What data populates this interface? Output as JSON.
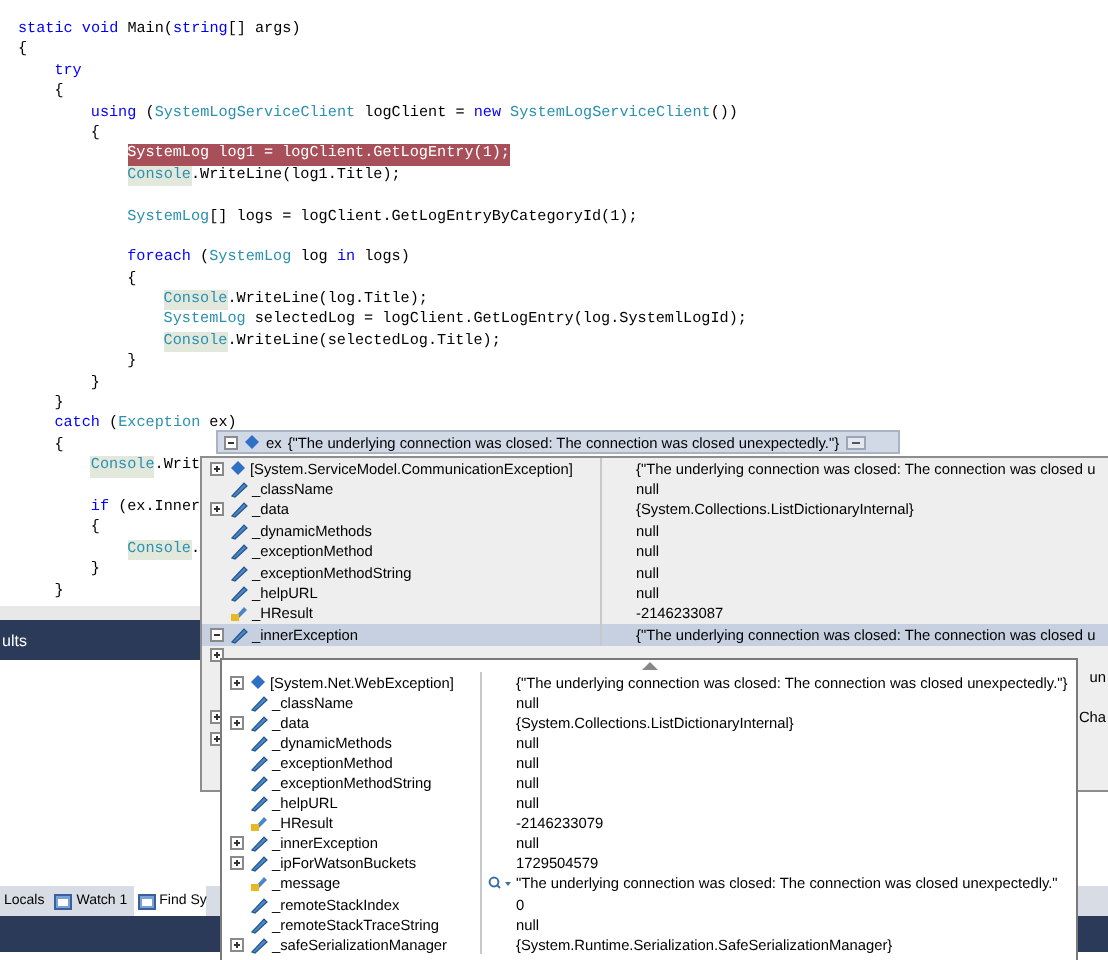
{
  "editor": {
    "lines": [
      {
        "kind": "code",
        "tokens": [
          {
            "t": "static",
            "kind": "kw"
          },
          {
            "t": " void",
            "kind": "kw"
          },
          {
            "t": " Main(",
            "kind": "plain"
          },
          {
            "t": "string",
            "kind": "kw"
          },
          {
            "t": "[] args)",
            "kind": "plain"
          }
        ]
      },
      {
        "kind": "code",
        "tokens": [
          {
            "t": "{",
            "kind": "plain"
          }
        ],
        "children": [
          {
            "kind": "code",
            "tokens": [
              {
                "t": "try",
                "kind": "kw"
              }
            ]
          },
          {
            "kind": "code",
            "tokens": [
              {
                "t": "{",
                "kind": "plain"
              }
            ],
            "children": [
              {
                "kind": "code",
                "tokens": [
                  {
                    "t": "using",
                    "kind": "kw"
                  },
                  {
                    "t": " (",
                    "kind": "plain"
                  },
                  {
                    "t": "SystemLogServiceClient",
                    "kind": "type"
                  },
                  {
                    "t": " logClient = ",
                    "kind": "plain"
                  },
                  {
                    "t": "new",
                    "kind": "kw"
                  },
                  {
                    "t": " SystemLogServiceClient",
                    "kind": "type"
                  },
                  {
                    "t": "())",
                    "kind": "plain"
                  }
                ]
              },
              {
                "kind": "code",
                "tokens": [
                  {
                    "t": "{",
                    "kind": "plain"
                  }
                ],
                "children": [
                  {
                    "kind": "code",
                    "tokens": [
                      {
                        "t": "SystemLog log1 = logClient.GetLogEntry(1);",
                        "kind": "current"
                      }
                    ]
                  },
                  {
                    "kind": "code",
                    "tokens": [
                      {
                        "t": "Console",
                        "kind": "ref"
                      },
                      {
                        "t": ".WriteLine(log1.Title);",
                        "kind": "plain"
                      }
                    ]
                  },
                  {
                    "kind": "blank"
                  },
                  {
                    "kind": "code",
                    "tokens": [
                      {
                        "t": "SystemLog",
                        "kind": "type"
                      },
                      {
                        "t": "[] logs = logClient.GetLogEntryByCategoryId(1);",
                        "kind": "plain"
                      }
                    ]
                  },
                  {
                    "kind": "blank"
                  },
                  {
                    "kind": "code",
                    "tokens": [
                      {
                        "t": "foreach",
                        "kind": "kw"
                      },
                      {
                        "t": " (",
                        "kind": "plain"
                      },
                      {
                        "t": "SystemLog",
                        "kind": "type"
                      },
                      {
                        "t": " log ",
                        "kind": "plain"
                      },
                      {
                        "t": "in",
                        "kind": "kw"
                      },
                      {
                        "t": " logs)",
                        "kind": "plain"
                      }
                    ]
                  },
                  {
                    "kind": "code",
                    "tokens": [
                      {
                        "t": "{",
                        "kind": "plain"
                      }
                    ],
                    "children": [
                      {
                        "kind": "code",
                        "tokens": [
                          {
                            "t": "Console",
                            "kind": "ref"
                          },
                          {
                            "t": ".WriteLine(log.Title);",
                            "kind": "plain"
                          }
                        ]
                      },
                      {
                        "kind": "code",
                        "tokens": [
                          {
                            "t": "SystemLog",
                            "kind": "type"
                          },
                          {
                            "t": " selectedLog = logClient.GetLogEntry(log.SystemlLogId);",
                            "kind": "plain"
                          }
                        ]
                      },
                      {
                        "kind": "code",
                        "tokens": [
                          {
                            "t": "Console",
                            "kind": "ref"
                          },
                          {
                            "t": ".WriteLine(selectedLog.Title);",
                            "kind": "plain"
                          }
                        ]
                      }
                    ]
                  },
                  {
                    "kind": "code",
                    "tokens": [
                      {
                        "t": "}",
                        "kind": "plain"
                      }
                    ]
                  }
                ]
              },
              {
                "kind": "code",
                "tokens": [
                  {
                    "t": "}",
                    "kind": "plain"
                  }
                ]
              }
            ]
          },
          {
            "kind": "code",
            "tokens": [
              {
                "t": "}",
                "kind": "plain"
              }
            ]
          },
          {
            "kind": "code",
            "tokens": [
              {
                "t": "catch",
                "kind": "kw"
              },
              {
                "t": " (",
                "kind": "plain"
              },
              {
                "t": "Exception",
                "kind": "type"
              },
              {
                "t": " ex)",
                "kind": "plain"
              }
            ]
          },
          {
            "kind": "code",
            "tokens": [
              {
                "t": "{",
                "kind": "plain"
              }
            ],
            "children": [
              {
                "kind": "code",
                "tokens": [
                  {
                    "t": "Console",
                    "kind": "ref"
                  },
                  {
                    "t": ".Writ",
                    "kind": "plain"
                  }
                ]
              },
              {
                "kind": "blank"
              },
              {
                "kind": "code",
                "tokens": [
                  {
                    "t": "if",
                    "kind": "kw"
                  },
                  {
                    "t": " (ex.Inner",
                    "kind": "plain"
                  }
                ]
              },
              {
                "kind": "code",
                "tokens": [
                  {
                    "t": "{",
                    "kind": "plain"
                  }
                ],
                "children": [
                  {
                    "kind": "code",
                    "tokens": [
                      {
                        "t": "Console",
                        "kind": "ref"
                      },
                      {
                        "t": ".",
                        "kind": "plain"
                      }
                    ]
                  }
                ]
              },
              {
                "kind": "code",
                "tokens": [
                  {
                    "t": "}",
                    "kind": "plain"
                  }
                ]
              }
            ]
          },
          {
            "kind": "code",
            "tokens": [
              {
                "t": "}",
                "kind": "plain"
              }
            ]
          }
        ]
      }
    ]
  },
  "output_panel": {
    "title": "ults"
  },
  "bottom_tabs": [
    {
      "label": "Locals",
      "icon": false,
      "selected": false
    },
    {
      "label": "Watch 1",
      "icon": true,
      "selected": false
    },
    {
      "label": "Find Sy",
      "icon": true,
      "selected": true
    }
  ],
  "datatip": {
    "name": "ex",
    "value": "{\"The underlying connection was closed: The connection was closed unexpectedly.\"}",
    "rows": [
      {
        "name": "[System.ServiceModel.CommunicationException]",
        "value": "{\"The underlying connection was closed: The connection was closed u",
        "kind": "property",
        "expandable": true,
        "expanded": false,
        "selected": false
      },
      {
        "name": "_className",
        "value": "null",
        "kind": "field",
        "expandable": false,
        "selected": false
      },
      {
        "name": "_data",
        "value": "{System.Collections.ListDictionaryInternal}",
        "kind": "field",
        "expandable": true,
        "expanded": false,
        "selected": false
      },
      {
        "name": "_dynamicMethods",
        "value": "null",
        "kind": "field",
        "expandable": false,
        "selected": false
      },
      {
        "name": "_exceptionMethod",
        "value": "null",
        "kind": "field",
        "expandable": false,
        "selected": false
      },
      {
        "name": "_exceptionMethodString",
        "value": "null",
        "kind": "field",
        "expandable": false,
        "selected": false
      },
      {
        "name": "_helpURL",
        "value": "null",
        "kind": "field",
        "expandable": false,
        "selected": false
      },
      {
        "name": "_HResult",
        "value": "-2146233087",
        "kind": "locked",
        "expandable": false,
        "selected": false
      },
      {
        "name": "_innerException",
        "value": "{\"The underlying connection was closed: The connection was closed u",
        "kind": "field",
        "expandable": true,
        "expanded": true,
        "selected": true
      }
    ],
    "covered_rows": [
      {
        "expandable": true
      },
      {
        "expandable": false,
        "value_end": "un"
      },
      {
        "expandable": false
      },
      {
        "expandable": true,
        "value_end": "Cha"
      },
      {
        "expandable": true
      },
      {
        "expandable": false
      },
      {
        "expandable": false
      }
    ],
    "child": {
      "rows": [
        {
          "name": "[System.Net.WebException]",
          "value": "{\"The underlying connection was closed: The connection was closed unexpectedly.\"}",
          "kind": "property",
          "expandable": true,
          "visualizer": false
        },
        {
          "name": "_className",
          "value": "null",
          "kind": "field",
          "expandable": false,
          "visualizer": false
        },
        {
          "name": "_data",
          "value": "{System.Collections.ListDictionaryInternal}",
          "kind": "field",
          "expandable": true,
          "visualizer": false
        },
        {
          "name": "_dynamicMethods",
          "value": "null",
          "kind": "field",
          "expandable": false,
          "visualizer": false
        },
        {
          "name": "_exceptionMethod",
          "value": "null",
          "kind": "field",
          "expandable": false,
          "visualizer": false
        },
        {
          "name": "_exceptionMethodString",
          "value": "null",
          "kind": "field",
          "expandable": false,
          "visualizer": false
        },
        {
          "name": "_helpURL",
          "value": "null",
          "kind": "field",
          "expandable": false,
          "visualizer": false
        },
        {
          "name": "_HResult",
          "value": "-2146233079",
          "kind": "locked",
          "expandable": false,
          "visualizer": false
        },
        {
          "name": "_innerException",
          "value": "null",
          "kind": "field",
          "expandable": true,
          "visualizer": false
        },
        {
          "name": "_ipForWatsonBuckets",
          "value": "1729504579",
          "kind": "field",
          "expandable": true,
          "visualizer": false
        },
        {
          "name": "_message",
          "value": "\"The underlying connection was closed: The connection was closed unexpectedly.\"",
          "kind": "locked",
          "expandable": false,
          "visualizer": true
        },
        {
          "name": "_remoteStackIndex",
          "value": "0",
          "kind": "field",
          "expandable": false,
          "visualizer": false
        },
        {
          "name": "_remoteStackTraceString",
          "value": "null",
          "kind": "field",
          "expandable": false,
          "visualizer": false
        },
        {
          "name": "_safeSerializationManager",
          "value": "{System.Runtime.Serialization.SafeSerializationManager}",
          "kind": "field",
          "expandable": true,
          "visualizer": false
        }
      ]
    }
  }
}
